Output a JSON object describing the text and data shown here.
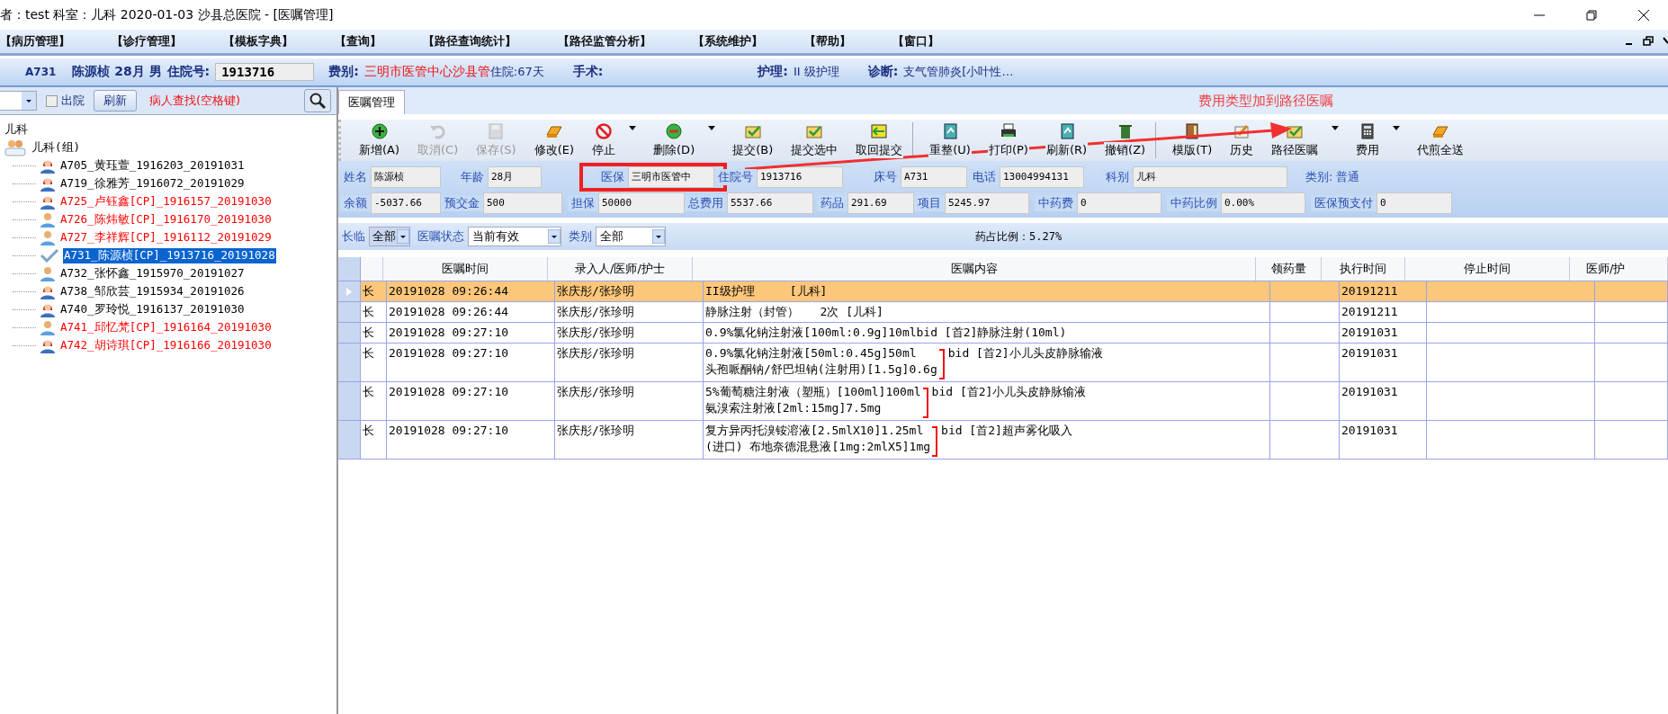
{
  "window": {
    "title": "者：test  科室：儿科  2020-01-03  沙县总医院 - [医嘱管理]"
  },
  "menu": [
    "【病历管理】",
    "【诊疗管理】",
    "【模板字典】",
    "【查询】",
    "【路径查询统计】",
    "【路径监管分析】",
    "【系统维护】",
    "【帮助】",
    "【窗口】"
  ],
  "patient_bar": {
    "bed": "A731",
    "name": "陈源桢 28月 男",
    "admission_label": "住院号:",
    "admission_no": "1913716",
    "fee_label": "费别:",
    "fee_type": "三明市医管中心沙县管",
    "stay": "住院:67天",
    "surgery": "手术:",
    "nursing_label": "护理:",
    "nursing": "II 级护理",
    "diagnosis_label": "诊断:",
    "diagnosis": "支气管肺炎[小叶性…"
  },
  "left_panel": {
    "discharged": {
      "label": "出院",
      "checked": false
    },
    "refresh": "刷新",
    "search_hint": "病人查找(空格键)",
    "tree": [
      {
        "label": "儿科",
        "selected": false,
        "children": [
          {
            "label": "儿科(组)",
            "kind": "group",
            "selected": false,
            "children": [
              {
                "label": "A705_黄珏萱_1916203_20191031",
                "kind": "female",
                "color": "#000000",
                "selected": false
              },
              {
                "label": "A719_徐雅芳_1916072_20191029",
                "kind": "female",
                "color": "#000000",
                "selected": false
              },
              {
                "label": "A725_卢钰鑫[CP]_1916157_20191030",
                "kind": "female",
                "color": "#ff0000",
                "selected": false
              },
              {
                "label": "A726_陈炜敏[CP]_1916170_20191030",
                "kind": "male",
                "color": "#ff0000",
                "selected": false
              },
              {
                "label": "A727_李祥辉[CP]_1916112_20191029",
                "kind": "male",
                "color": "#ff0000",
                "selected": false
              },
              {
                "label": "A731_陈源桢[CP]_1913716_20191028",
                "kind": "check",
                "selected": true
              },
              {
                "label": "A732_张怀鑫_1915970_20191027",
                "kind": "male",
                "color": "#000000",
                "selected": false
              },
              {
                "label": "A738_邹欣芸_1915934_20191026",
                "kind": "female",
                "color": "#000000",
                "selected": false
              },
              {
                "label": "A740_罗玲悦_1916137_20191030",
                "kind": "female",
                "color": "#000000",
                "selected": false
              },
              {
                "label": "A741_邱忆梵[CP]_1916164_20191030",
                "kind": "male",
                "color": "#ff0000",
                "selected": false
              },
              {
                "label": "A742_胡诗琪[CP]_1916166_20191030",
                "kind": "female",
                "color": "#ff0000",
                "selected": false
              }
            ]
          }
        ]
      }
    ]
  },
  "tab": {
    "label": "医嘱管理",
    "selected": true
  },
  "annotation": "费用类型加到路径医嘱",
  "toolbar": [
    {
      "label": "新增(A)",
      "kind": "add",
      "disabled": false,
      "dropdown": false,
      "separator": false
    },
    {
      "label": "取消(C)",
      "kind": "undo",
      "disabled": true,
      "dropdown": false,
      "separator": false
    },
    {
      "label": "保存(S)",
      "kind": "save",
      "disabled": true,
      "dropdown": false,
      "separator": false
    },
    {
      "label": "修改(E)",
      "kind": "eraser",
      "disabled": false,
      "dropdown": false,
      "separator": false
    },
    {
      "label": "停止",
      "kind": "stop",
      "disabled": false,
      "dropdown": true,
      "separator": false
    },
    {
      "label": "删除(D)",
      "kind": "minus",
      "disabled": false,
      "dropdown": true,
      "separator": false
    },
    {
      "label": "提交(B)",
      "kind": "mail",
      "disabled": false,
      "dropdown": false,
      "separator": false
    },
    {
      "label": "提交选中",
      "kind": "mail",
      "disabled": false,
      "dropdown": false,
      "separator": false
    },
    {
      "label": "取回提交",
      "kind": "back",
      "disabled": false,
      "dropdown": false,
      "separator": true
    },
    {
      "label": "重整(U)",
      "kind": "doc",
      "disabled": false,
      "dropdown": false,
      "separator": false
    },
    {
      "label": "打印(P)",
      "kind": "printer",
      "disabled": false,
      "dropdown": false,
      "separator": false
    },
    {
      "label": "刷新(R)",
      "kind": "doc",
      "disabled": false,
      "dropdown": false,
      "separator": false
    },
    {
      "label": "撤销(Z)",
      "kind": "trash",
      "disabled": false,
      "dropdown": false,
      "separator": true
    },
    {
      "label": "模版(T)",
      "kind": "book",
      "disabled": false,
      "dropdown": false,
      "separator": false
    },
    {
      "label": "历史",
      "kind": "pencil",
      "disabled": false,
      "dropdown": false,
      "separator": false
    },
    {
      "label": "路径医嘱",
      "kind": "mail",
      "disabled": false,
      "dropdown": true,
      "separator": false
    },
    {
      "label": "费用",
      "kind": "calc",
      "disabled": false,
      "dropdown": true,
      "separator": false
    },
    {
      "label": "代煎全送",
      "kind": "eraser",
      "disabled": false,
      "dropdown": false,
      "separator": false
    }
  ],
  "info": [
    [
      {
        "label": "姓名",
        "value": "陈源桢",
        "kind": "field"
      },
      {
        "label": "年龄",
        "value": "28月",
        "kind": "field"
      },
      {
        "label": "医保",
        "value": "三明市医管中",
        "kind": "field"
      },
      {
        "label": "住院号",
        "value": "1913716",
        "kind": "field"
      },
      {
        "label": "床号",
        "value": "A731",
        "kind": "field"
      },
      {
        "label": "电话",
        "value": "13004994131",
        "kind": "field"
      },
      {
        "label": "科别",
        "value": "儿科",
        "kind": "field"
      },
      {
        "label": "类别:",
        "value": "普通",
        "kind": "text"
      }
    ],
    [
      {
        "label": "余额",
        "value": "-5037.66",
        "kind": "field"
      },
      {
        "label": "预交金",
        "value": "500",
        "kind": "field"
      },
      {
        "label": "担保",
        "value": "50000",
        "kind": "field"
      },
      {
        "label": "总费用",
        "value": "5537.66",
        "kind": "field"
      },
      {
        "label": "药品",
        "value": "291.69",
        "kind": "field"
      },
      {
        "label": "项目",
        "value": "5245.97",
        "kind": "field"
      },
      {
        "label": "中药费",
        "value": "0",
        "kind": "field"
      },
      {
        "label": "中药比例",
        "value": "0.00%",
        "kind": "field"
      },
      {
        "label": "医保预支付",
        "value": "0",
        "kind": "field"
      }
    ]
  ],
  "filters": [
    {
      "label": "长临",
      "value": "全部"
    },
    {
      "label": "医嘱状态",
      "value": "当前有效"
    },
    {
      "label": "类别",
      "value": "全部"
    }
  ],
  "drug_ratio": "药占比例：5.27%",
  "table": {
    "columns": [
      "医嘱时间",
      "录入人/医师/护士",
      "医嘱内容",
      "领药量",
      "执行时间",
      "停止时间",
      "医师/护"
    ],
    "rows": [
      {
        "type": "长",
        "time": "20191028 09:26:44",
        "staff": "张庆彤/张珍明",
        "lines": [
          "II级护理     [儿科]"
        ],
        "suffix": "",
        "bracket": false,
        "exec": "20191211",
        "selected": true
      },
      {
        "type": "长",
        "time": "20191028 09:26:44",
        "staff": "张庆彤/张珍明",
        "lines": [
          "静脉注射（封管）   2次 [儿科]"
        ],
        "suffix": "",
        "bracket": false,
        "exec": "20191211",
        "selected": false
      },
      {
        "type": "长",
        "time": "20191028 09:27:10",
        "staff": "张庆彤/张珍明",
        "lines": [
          "0.9%氯化钠注射液[100ml:0.9g]10mlbid [首2]静脉注射(10ml)"
        ],
        "suffix": "",
        "bracket": false,
        "exec": "20191031",
        "selected": false
      },
      {
        "type": "长",
        "time": "20191028 09:27:10",
        "staff": "张庆彤/张珍明",
        "lines": [
          "0.9%氯化钠注射液[50ml:0.45g]50ml",
          "头孢哌酮钠/舒巴坦钠(注射用)[1.5g]0.6g"
        ],
        "suffix": "bid [首2]小儿头皮静脉输液",
        "bracket": true,
        "exec": "20191031",
        "selected": false
      },
      {
        "type": "长",
        "time": "20191028 09:27:10",
        "staff": "张庆彤/张珍明",
        "lines": [
          "5%葡萄糖注射液（塑瓶）[100ml]100ml",
          "氨溴索注射液[2ml:15mg]7.5mg"
        ],
        "suffix": "bid [首2]小儿头皮静脉输液",
        "bracket": true,
        "exec": "20191031",
        "selected": false
      },
      {
        "type": "长",
        "time": "20191028 09:27:10",
        "staff": "张庆彤/张珍明",
        "lines": [
          "复方异丙托溴铵溶液[2.5mlX10]1.25ml",
          "(进口) 布地奈德混悬液[1mg:2mlX5]1mg"
        ],
        "suffix": "bid [首2]超声雾化吸入",
        "bracket": true,
        "exec": "20191031",
        "selected": false
      }
    ]
  }
}
